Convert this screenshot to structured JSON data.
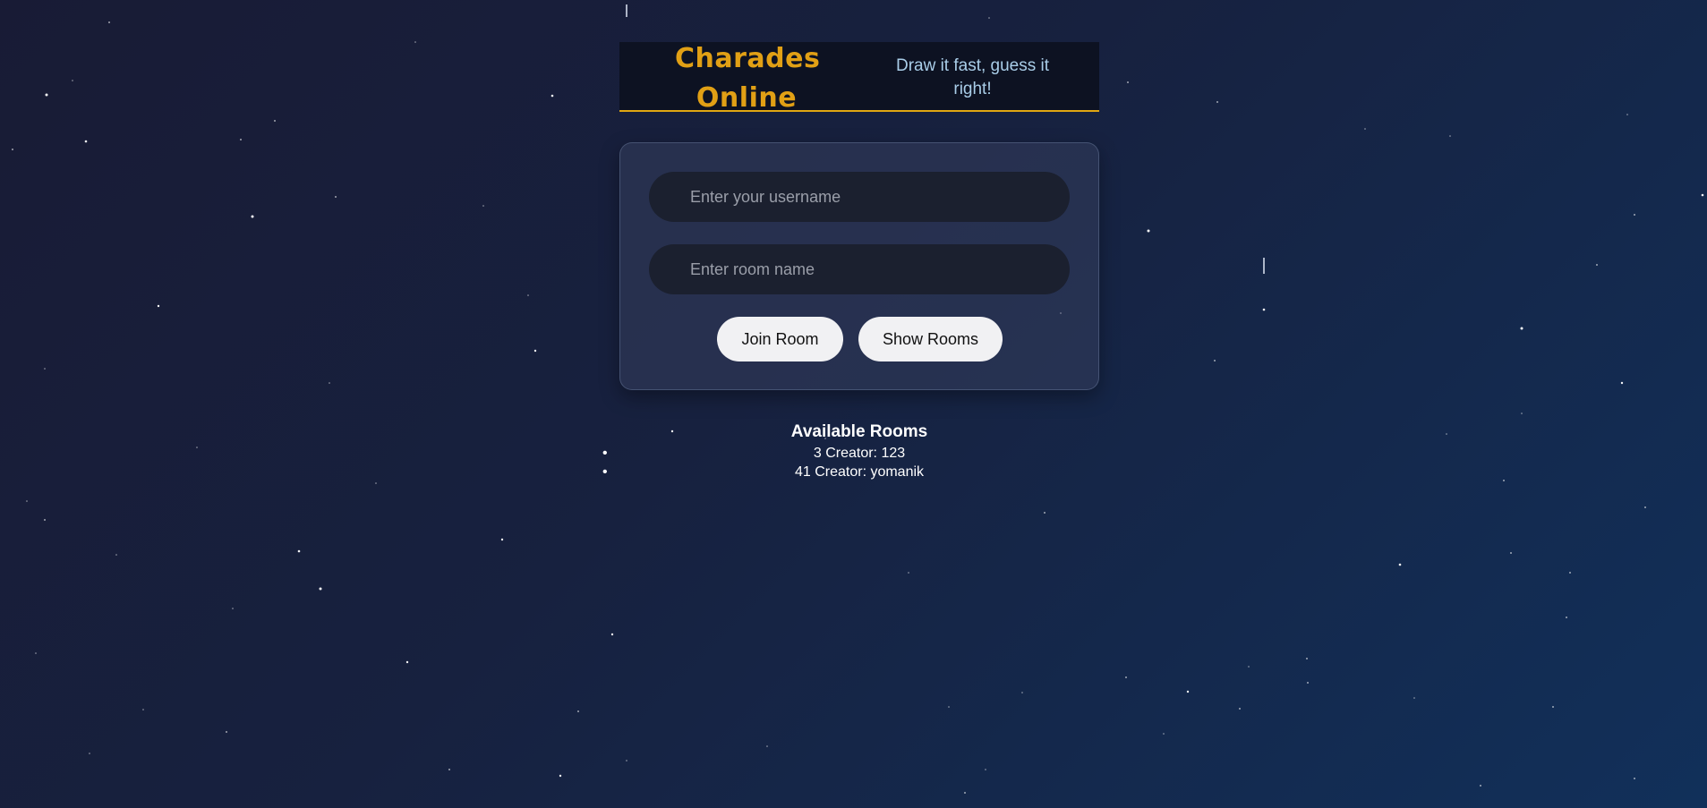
{
  "header": {
    "title": "Charades Online",
    "tagline": "Draw it fast, guess it right!"
  },
  "form": {
    "username_placeholder": "Enter your username",
    "username_value": "",
    "room_placeholder": "Enter room name",
    "room_value": "",
    "join_label": "Join Room",
    "show_label": "Show Rooms"
  },
  "rooms": {
    "title": "Available Rooms",
    "items": [
      {
        "label": "3 Creator: 123"
      },
      {
        "label": "41 Creator: yomanik"
      }
    ]
  },
  "colors": {
    "accent": "#e1a015",
    "tagline": "#a9cde8",
    "card_bg": "#2b3452",
    "input_bg": "#1b202f",
    "button_bg": "#f1f1f3"
  }
}
